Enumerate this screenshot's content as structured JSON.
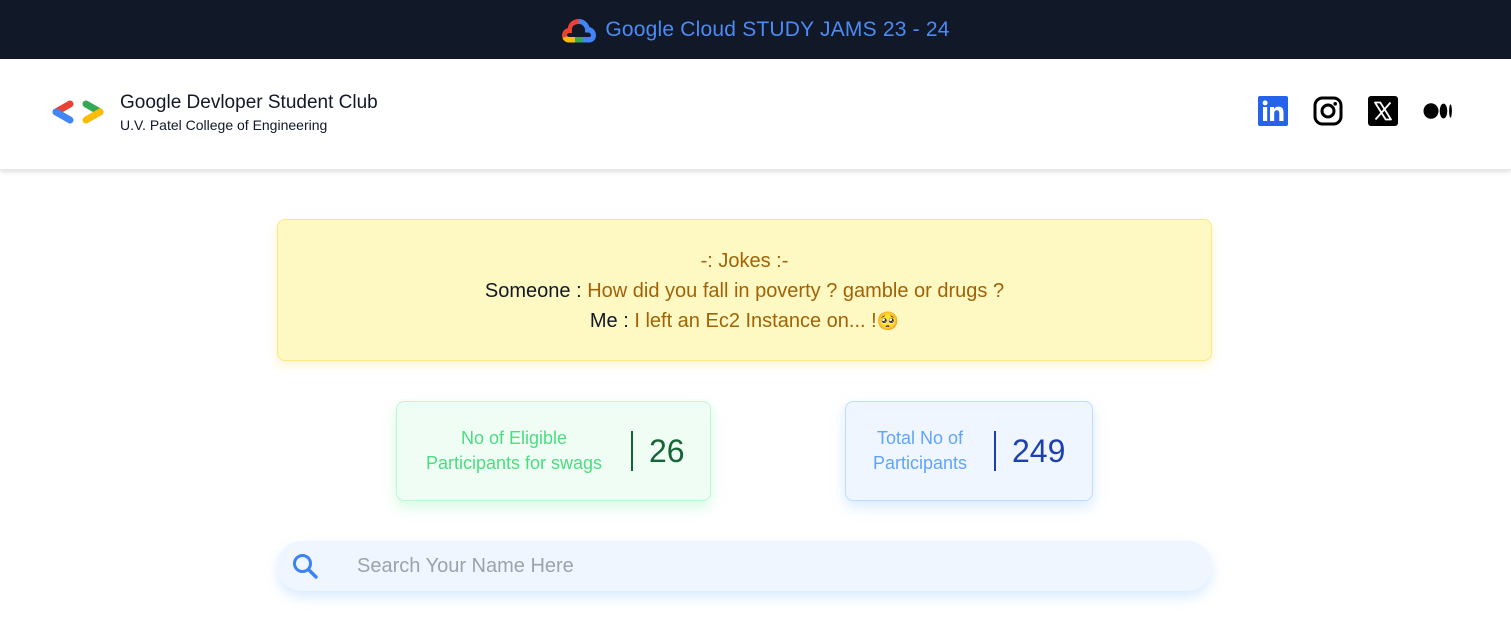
{
  "banner": {
    "title": "Google Cloud STUDY JAMS 23 - 24",
    "logo_icon": "google-cloud-logo"
  },
  "header": {
    "club_name": "Google Devloper Student Club",
    "college_name": "U.V. Patel College of Engineering",
    "logo_icon": "gdsc-logo",
    "socials": [
      {
        "icon": "linkedin-icon",
        "color": "#2563eb"
      },
      {
        "icon": "instagram-icon",
        "color": "#000000"
      },
      {
        "icon": "x-twitter-icon",
        "color": "#000000"
      },
      {
        "icon": "medium-icon",
        "color": "#000000"
      }
    ]
  },
  "joke": {
    "heading": "-: Jokes :-",
    "line1_speaker": "Someone :",
    "line1_text": "How did you fall in poverty ? gamble or drugs ?",
    "line2_speaker": "Me :",
    "line2_text": "I left an Ec2 Instance on... !",
    "emoji": "🥺"
  },
  "stats": {
    "eligible": {
      "label_line1": "No of Eligible",
      "label_line2": "Participants for swags",
      "value": "26"
    },
    "total": {
      "label_line1": "Total No of",
      "label_line2": "Participants",
      "value": "249"
    }
  },
  "search": {
    "placeholder": "Search Your Name Here",
    "value": ""
  },
  "colors": {
    "banner_bg": "#111827",
    "banner_text": "#4c8bf5",
    "joke_bg": "#fef9c3",
    "joke_accent": "#a16207",
    "eligible_bg": "#f0fdf4",
    "eligible_value": "#166534",
    "total_bg": "#eff6ff",
    "total_value": "#1e40af",
    "search_icon": "#3b82f6"
  }
}
